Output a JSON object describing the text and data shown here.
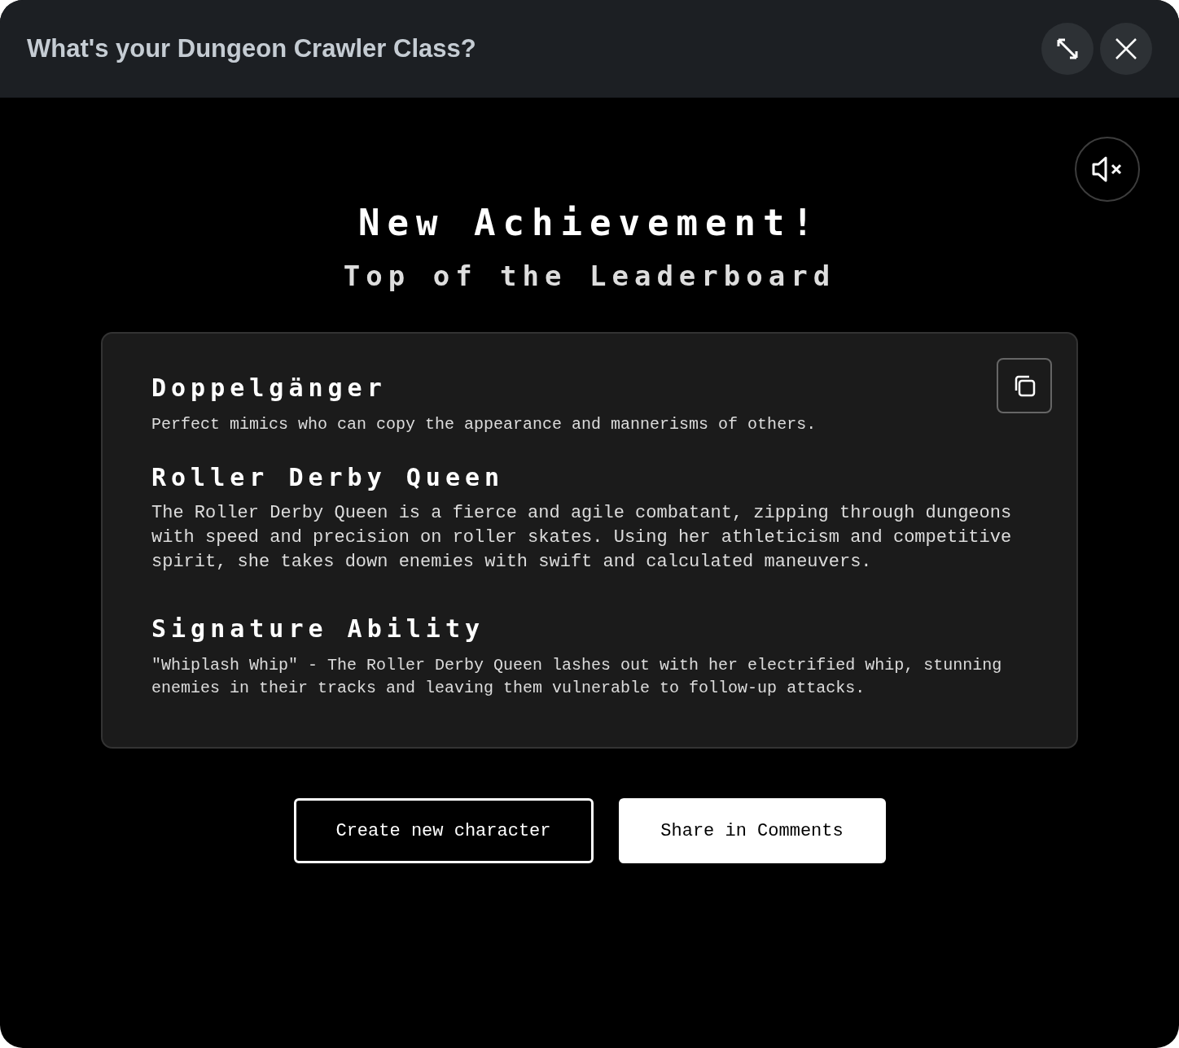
{
  "window": {
    "title": "What's your Dungeon Crawler Class?"
  },
  "sound": {
    "muted": true
  },
  "heading": "New Achievement!",
  "subheading": "Top of the Leaderboard",
  "card": {
    "sections": [
      {
        "kind": "small",
        "title": "Doppelgänger",
        "text": "Perfect mimics who can copy the appearance and mannerisms of others."
      },
      {
        "kind": "large",
        "title": "Roller Derby Queen",
        "text": "The Roller Derby Queen is a fierce and agile combatant, zipping through dungeons with speed and precision on roller skates. Using her athleticism and competitive spirit, she takes down enemies with swift and calculated maneuvers."
      },
      {
        "kind": "small",
        "title": "Signature Ability",
        "text": "\"Whiplash Whip\" - The Roller Derby Queen lashes out with her electrified whip, stunning enemies in their tracks and leaving them vulnerable to follow-up attacks."
      }
    ]
  },
  "buttons": [
    {
      "kind": "outline",
      "label": "Create new character"
    },
    {
      "kind": "solid",
      "label": "Share in Comments"
    }
  ]
}
